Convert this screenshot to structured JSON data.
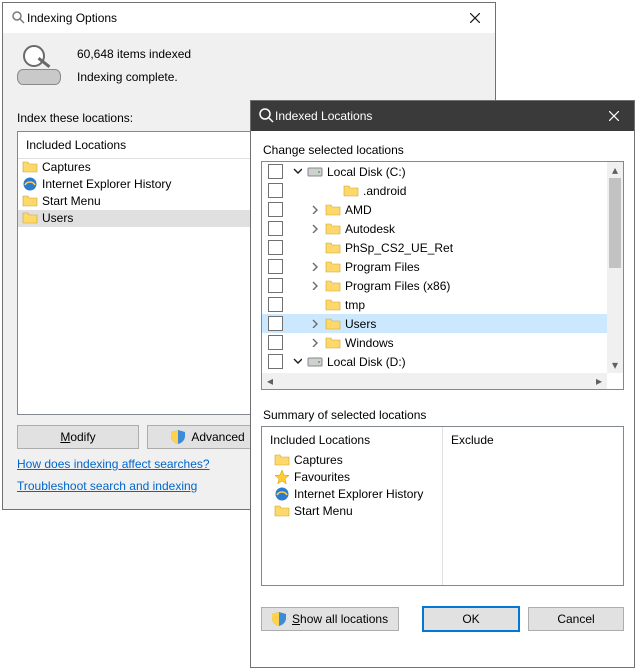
{
  "win1": {
    "title": "Indexing Options",
    "items_indexed": "60,648 items indexed",
    "status": "Indexing complete.",
    "index_these": "Index these locations:",
    "list_header": "Included Locations",
    "rows": [
      {
        "icon": "folder",
        "label": "Captures",
        "sel": false
      },
      {
        "icon": "ie",
        "label": "Internet Explorer History",
        "sel": false
      },
      {
        "icon": "folder",
        "label": "Start Menu",
        "sel": false
      },
      {
        "icon": "folder",
        "label": "Users",
        "sel": true
      }
    ],
    "modify_label": "Modify",
    "advanced_label": "Advanced",
    "link1": "How does indexing affect searches?",
    "link2": "Troubleshoot search and indexing"
  },
  "win2": {
    "title": "Indexed Locations",
    "change_label": "Change selected locations",
    "tree": [
      {
        "indent": 0,
        "cb": true,
        "chev": "open",
        "icon": "drive",
        "label": "Local Disk (C:)"
      },
      {
        "indent": 2,
        "cb": true,
        "chev": "",
        "icon": "folder",
        "label": ".android"
      },
      {
        "indent": 1,
        "cb": true,
        "chev": "closed",
        "icon": "folder",
        "label": "AMD"
      },
      {
        "indent": 1,
        "cb": true,
        "chev": "closed",
        "icon": "folder",
        "label": "Autodesk"
      },
      {
        "indent": 1,
        "cb": true,
        "chev": "",
        "icon": "folder",
        "label": "PhSp_CS2_UE_Ret"
      },
      {
        "indent": 1,
        "cb": true,
        "chev": "closed",
        "icon": "folder",
        "label": "Program Files"
      },
      {
        "indent": 1,
        "cb": true,
        "chev": "closed",
        "icon": "folder",
        "label": "Program Files (x86)"
      },
      {
        "indent": 1,
        "cb": true,
        "chev": "",
        "icon": "folder",
        "label": "tmp"
      },
      {
        "indent": 1,
        "cb": true,
        "chev": "closed",
        "icon": "folder",
        "label": "Users",
        "sel": true
      },
      {
        "indent": 1,
        "cb": true,
        "chev": "closed",
        "icon": "folder",
        "label": "Windows"
      },
      {
        "indent": 0,
        "cb": true,
        "chev": "open",
        "icon": "drive",
        "label": "Local Disk (D:)"
      }
    ],
    "summary_label": "Summary of selected locations",
    "included_header": "Included Locations",
    "exclude_header": "Exclude",
    "included": [
      {
        "icon": "folder",
        "label": "Captures"
      },
      {
        "icon": "star",
        "label": "Favourites"
      },
      {
        "icon": "ie",
        "label": "Internet Explorer History"
      },
      {
        "icon": "folder",
        "label": "Start Menu"
      }
    ],
    "show_all": "Show all locations",
    "ok": "OK",
    "cancel": "Cancel"
  }
}
